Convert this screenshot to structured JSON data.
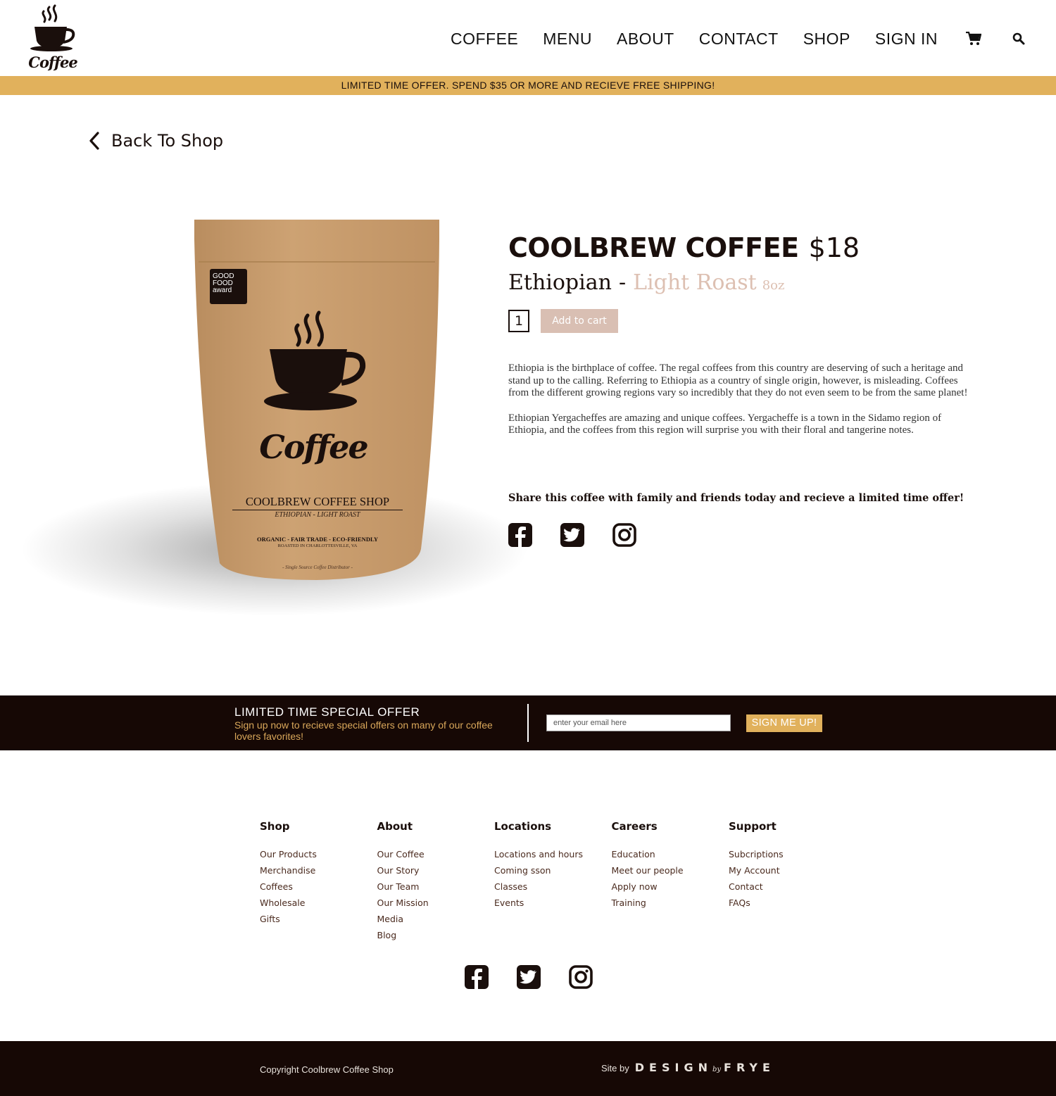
{
  "header": {
    "logo_text": "Coffee",
    "nav": [
      "COFFEE",
      "MENU",
      "ABOUT",
      "CONTACT",
      "SHOP",
      "SIGN IN"
    ],
    "icons": [
      "cart-icon",
      "search-icon"
    ]
  },
  "promo": "LIMITED TIME OFFER. SPEND $35 OR MORE AND RECIEVE FREE SHIPPING!",
  "back_link": "Back To Shop",
  "product": {
    "name": "COOLBREW COFFEE",
    "price": "$18",
    "origin": "Ethiopian",
    "dash": "-",
    "roast": "Light Roast",
    "size": "8oz",
    "quantity": "1",
    "add_to_cart": "Add to cart",
    "description": [
      "Ethiopia is the birthplace of coffee. The regal coffees from this country are deserving of such a heritage and stand up to the calling. Referring to Ethiopia as a country of single origin, however, is misleading. Coffees from the different growing regions vary so incredibly that they do not even seem to be from the same planet!",
      "Ethiopian Yergacheffes are amazing and unique coffees. Yergacheffe is a town in the Sidamo region of Ethiopia, and the coffees from this region will surprise you with their floral and tangerine notes."
    ],
    "share_text": "Share this coffee with family and friends today and recieve a limited time offer!"
  },
  "bag": {
    "award": "GOOD FOOD award",
    "brand_script": "Coffee",
    "shop": "COOLBREW COFFEE SHOP",
    "variety": "ETHIOPIAN - LIGHT ROAST",
    "tags": "ORGANIC - FAIR TRADE - ECO-FRIENDLY",
    "roasted": "ROASTED IN CHARLOTTESVILLE, VA",
    "tagline": "- Single Source Coffee Distributor -"
  },
  "newsletter": {
    "title": "LIMITED TIME SPECIAL OFFER",
    "subtitle": "Sign up now to recieve special offers on many of our coffee lovers favorites!",
    "placeholder": "enter your email here",
    "button": "SIGN ME UP!"
  },
  "footer": {
    "columns": [
      {
        "heading": "Shop",
        "links": [
          "Our Products",
          "Merchandise",
          "Coffees",
          "Wholesale",
          "Gifts"
        ]
      },
      {
        "heading": "About",
        "links": [
          "Our Coffee",
          "Our Story",
          "Our Team",
          "Our Mission",
          "Media",
          "Blog"
        ]
      },
      {
        "heading": "Locations",
        "links": [
          "Locations and hours",
          "Coming sson",
          "Classes",
          "Events"
        ]
      },
      {
        "heading": "Careers",
        "links": [
          "Education",
          "Meet our people",
          "Apply now",
          "Training"
        ]
      },
      {
        "heading": "Support",
        "links": [
          "Subcriptions",
          "My Account",
          "Contact",
          "FAQs"
        ]
      }
    ],
    "copyright": "Copyright Coolbrew Coffee Shop",
    "site_by": "Site by",
    "designer_1": "DESIGN",
    "designer_by": "by",
    "designer_2": "FRYE"
  },
  "colors": {
    "accent_gold": "#e1b15c",
    "dark_brown": "#160805",
    "roast_pink": "#ddc0b2",
    "kraft": "#c69a6a"
  }
}
